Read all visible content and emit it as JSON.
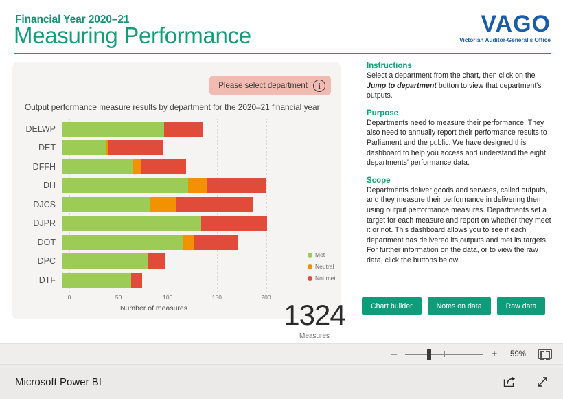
{
  "header": {
    "financial_year": "Financial Year 2020–21",
    "title": "Measuring Performance",
    "logo_main": "VAGO",
    "logo_sub": "Victorian Auditor-General's Office"
  },
  "chart_card": {
    "select_pill_label": "Please select department",
    "info_icon_glyph": "i",
    "chart_title": "Output performance measure results by department for the 2020–21 financial year",
    "kpi_value": "1324",
    "kpi_label": "Measures",
    "legend": [
      {
        "label": "Met",
        "color": "#9ccb56"
      },
      {
        "label": "Neutral",
        "color": "#f29200"
      },
      {
        "label": "Not met",
        "color": "#e04c39"
      }
    ]
  },
  "chart_data": {
    "type": "bar",
    "orientation": "horizontal",
    "stacked": true,
    "title": "Output performance measure results by department for the 2020–21 financial year",
    "xlabel": "Number of measures",
    "ylabel": "",
    "xlim": [
      0,
      215
    ],
    "xticks": [
      0,
      50,
      100,
      150,
      200
    ],
    "xtick_labels": [
      "0",
      "50",
      "100",
      "150",
      "200"
    ],
    "grid": true,
    "legend_position": "right-inside",
    "categories": [
      "DELWP",
      "DET",
      "DFFH",
      "DH",
      "DJCS",
      "DJPR",
      "DOT",
      "DPC",
      "DTF"
    ],
    "series": [
      {
        "name": "Met",
        "color": "#9ccb56",
        "values": [
          103,
          44,
          72,
          128,
          89,
          141,
          123,
          87,
          70
        ]
      },
      {
        "name": "Neutral",
        "color": "#f29200",
        "values": [
          0,
          3,
          8,
          19,
          26,
          0,
          10,
          0,
          0
        ]
      },
      {
        "name": "Not met",
        "color": "#e04c39",
        "values": [
          40,
          55,
          46,
          60,
          79,
          67,
          46,
          17,
          11
        ]
      }
    ],
    "totals": [
      143,
      102,
      126,
      207,
      194,
      208,
      179,
      104,
      81
    ],
    "total_measures": 1324
  },
  "info_panel": {
    "sections": [
      {
        "heading": "Instructions",
        "body_before": "Select a department from the chart, then click on the ",
        "body_emphasis": "Jump to department",
        "body_after": " button to view that department's outputs."
      },
      {
        "heading": "Purpose",
        "body": "Departments need to measure their performance. They also need to annually report their performance results to Parliament and the public. We have designed this dashboard to help you access and understand the eight departments' performance data."
      },
      {
        "heading": "Scope",
        "body": "Departments deliver goods and services, called outputs, and they measure their performance in delivering them using output performance measures. Departments set a target for each measure and report on whether they meet it or not. This dashboard allows you to see if each department has delivered its outputs and met its targets. For further information on the data, or to view the raw data, click the buttons below."
      }
    ],
    "buttons": [
      {
        "label": "Chart builder"
      },
      {
        "label": "Notes on data"
      },
      {
        "label": "Raw data"
      }
    ]
  },
  "status_strip": {
    "zoom_out_glyph": "–",
    "zoom_in_glyph": "+",
    "zoom_percent": "59%"
  },
  "bottom_bar": {
    "product_name": "Microsoft Power BI"
  },
  "colors": {
    "brand_teal": "#159c7b",
    "logo_blue": "#1a5ca8",
    "met": "#9ccb56",
    "neutral": "#f29200",
    "not_met": "#e04c39",
    "pill_pink": "#f2bbb2"
  }
}
